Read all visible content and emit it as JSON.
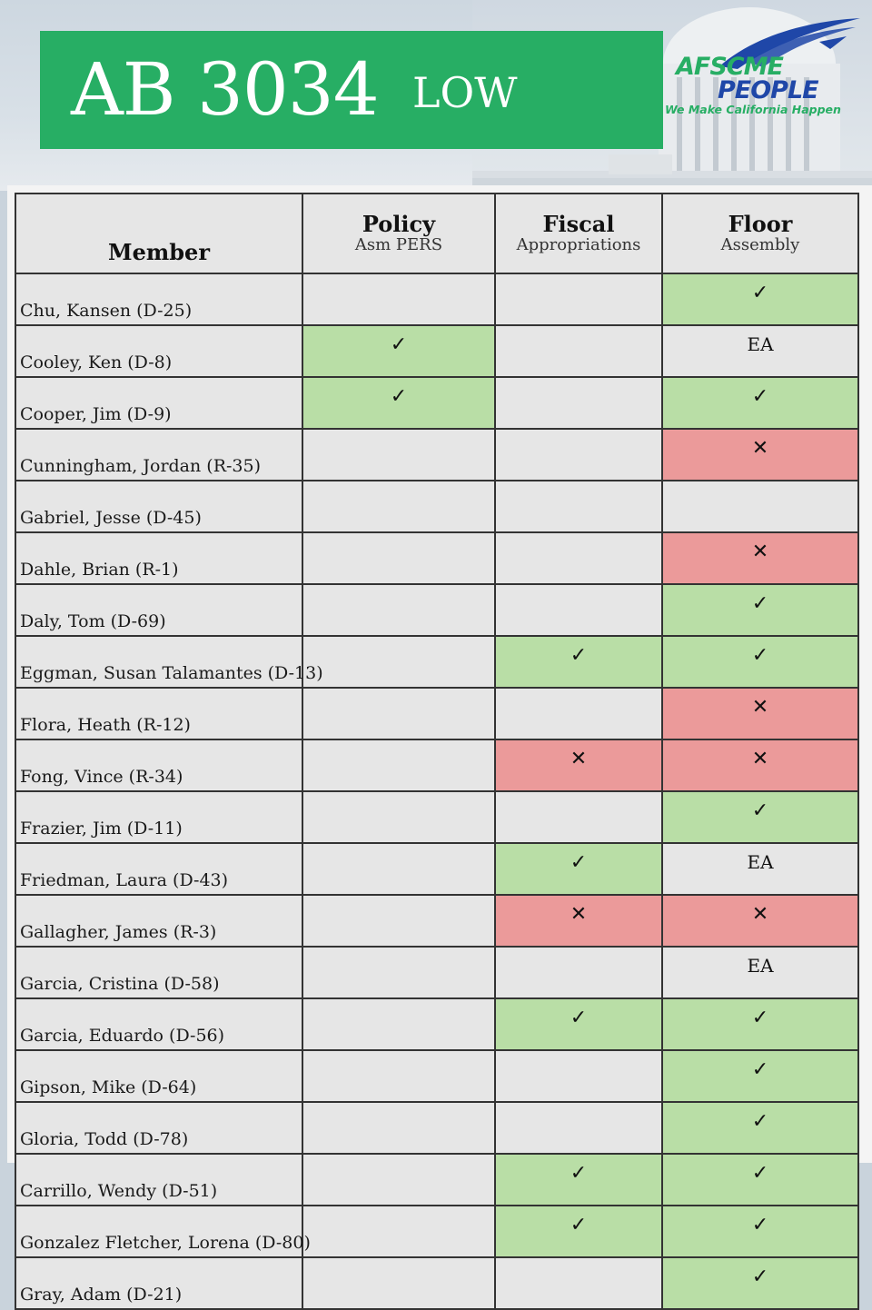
{
  "header": {
    "bill": "AB 3034",
    "rating": "LOW",
    "logo": {
      "line1": "AFSCME",
      "line2": "PEOPLE",
      "tagline": "We Make California Happen"
    }
  },
  "colors": {
    "title_bg": "#27ae64",
    "yes_bg": "#b9dea6",
    "no_bg": "#eb9a9a",
    "neutral_bg": "#e6e6e6"
  },
  "table": {
    "columns": [
      {
        "title": "Member",
        "subtitle": ""
      },
      {
        "title": "Policy",
        "subtitle": "Asm PERS"
      },
      {
        "title": "Fiscal",
        "subtitle": "Appropriations"
      },
      {
        "title": "Floor",
        "subtitle": "Assembly"
      }
    ],
    "rows": [
      {
        "name": "Chu, Kansen (D-25)",
        "policy": "",
        "fiscal": "",
        "floor": "yes"
      },
      {
        "name": "Cooley, Ken (D-8)",
        "policy": "yes",
        "fiscal": "",
        "floor": "EA"
      },
      {
        "name": "Cooper, Jim (D-9)",
        "policy": "yes",
        "fiscal": "",
        "floor": "yes"
      },
      {
        "name": "Cunningham, Jordan (R-35)",
        "policy": "",
        "fiscal": "",
        "floor": "no"
      },
      {
        "name": "Gabriel, Jesse (D-45)",
        "policy": "",
        "fiscal": "",
        "floor": ""
      },
      {
        "name": "Dahle, Brian (R-1)",
        "policy": "",
        "fiscal": "",
        "floor": "no"
      },
      {
        "name": "Daly, Tom (D-69)",
        "policy": "",
        "fiscal": "",
        "floor": "yes"
      },
      {
        "name": "Eggman, Susan Talamantes (D-13)",
        "policy": "",
        "fiscal": "yes",
        "floor": "yes"
      },
      {
        "name": "Flora, Heath (R-12)",
        "policy": "",
        "fiscal": "",
        "floor": "no"
      },
      {
        "name": "Fong, Vince (R-34)",
        "policy": "",
        "fiscal": "no",
        "floor": "no"
      },
      {
        "name": "Frazier, Jim (D-11)",
        "policy": "",
        "fiscal": "",
        "floor": "yes"
      },
      {
        "name": "Friedman, Laura (D-43)",
        "policy": "",
        "fiscal": "yes",
        "floor": "EA"
      },
      {
        "name": "Gallagher, James (R-3)",
        "policy": "",
        "fiscal": "no",
        "floor": "no"
      },
      {
        "name": "Garcia, Cristina (D-58)",
        "policy": "",
        "fiscal": "",
        "floor": "EA"
      },
      {
        "name": "Garcia, Eduardo (D-56)",
        "policy": "",
        "fiscal": "yes",
        "floor": "yes"
      },
      {
        "name": "Gipson, Mike (D-64)",
        "policy": "",
        "fiscal": "",
        "floor": "yes"
      },
      {
        "name": "Gloria, Todd (D-78)",
        "policy": "",
        "fiscal": "",
        "floor": "yes"
      },
      {
        "name": "Carrillo, Wendy (D-51)",
        "policy": "",
        "fiscal": "yes",
        "floor": "yes"
      },
      {
        "name": "Gonzalez Fletcher, Lorena (D-80)",
        "policy": "",
        "fiscal": "yes",
        "floor": "yes"
      },
      {
        "name": "Gray, Adam (D-21)",
        "policy": "",
        "fiscal": "",
        "floor": "yes"
      }
    ],
    "marks": {
      "yes": "✓",
      "no": "✕",
      "EA": "EA"
    }
  }
}
